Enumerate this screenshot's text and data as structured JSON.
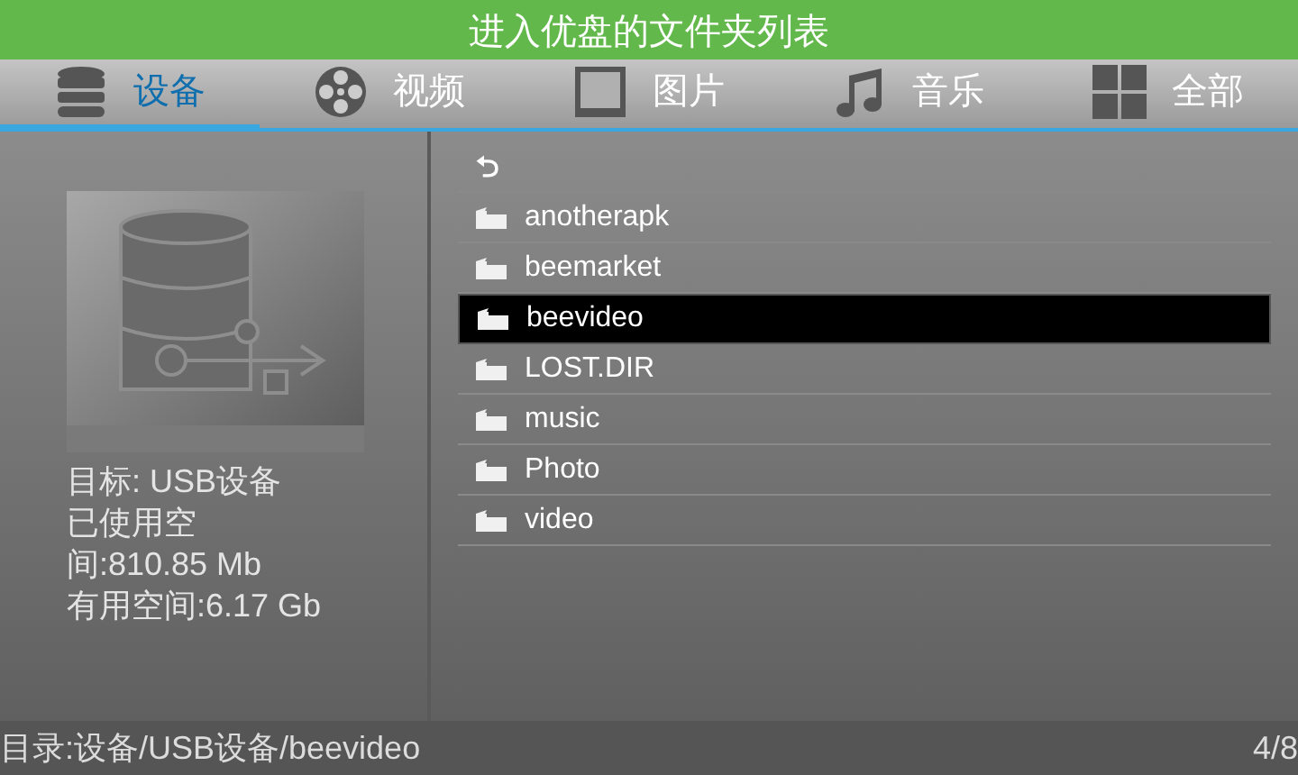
{
  "banner": {
    "title": "进入优盘的文件夹列表"
  },
  "tabs": [
    {
      "label": "设备",
      "kind": "device",
      "selected": true
    },
    {
      "label": "视频",
      "kind": "video",
      "selected": false
    },
    {
      "label": "图片",
      "kind": "image",
      "selected": false
    },
    {
      "label": "音乐",
      "kind": "music",
      "selected": false
    },
    {
      "label": "全部",
      "kind": "all",
      "selected": false
    }
  ],
  "device_info": [
    "目标: USB设备",
    "已使用空",
    "间:810.85 Mb",
    "有用空间:6.17 Gb"
  ],
  "files": {
    "back": "⮌",
    "items": [
      {
        "name": "anotherapk",
        "selected": false
      },
      {
        "name": "beemarket",
        "selected": false
      },
      {
        "name": "beevideo",
        "selected": true
      },
      {
        "name": "LOST.DIR",
        "selected": false
      },
      {
        "name": "music",
        "selected": false
      },
      {
        "name": "Photo",
        "selected": false
      },
      {
        "name": "video",
        "selected": false
      }
    ]
  },
  "status_bar": {
    "path": "目录:设备/USB设备/beevideo",
    "position": "4/8"
  }
}
